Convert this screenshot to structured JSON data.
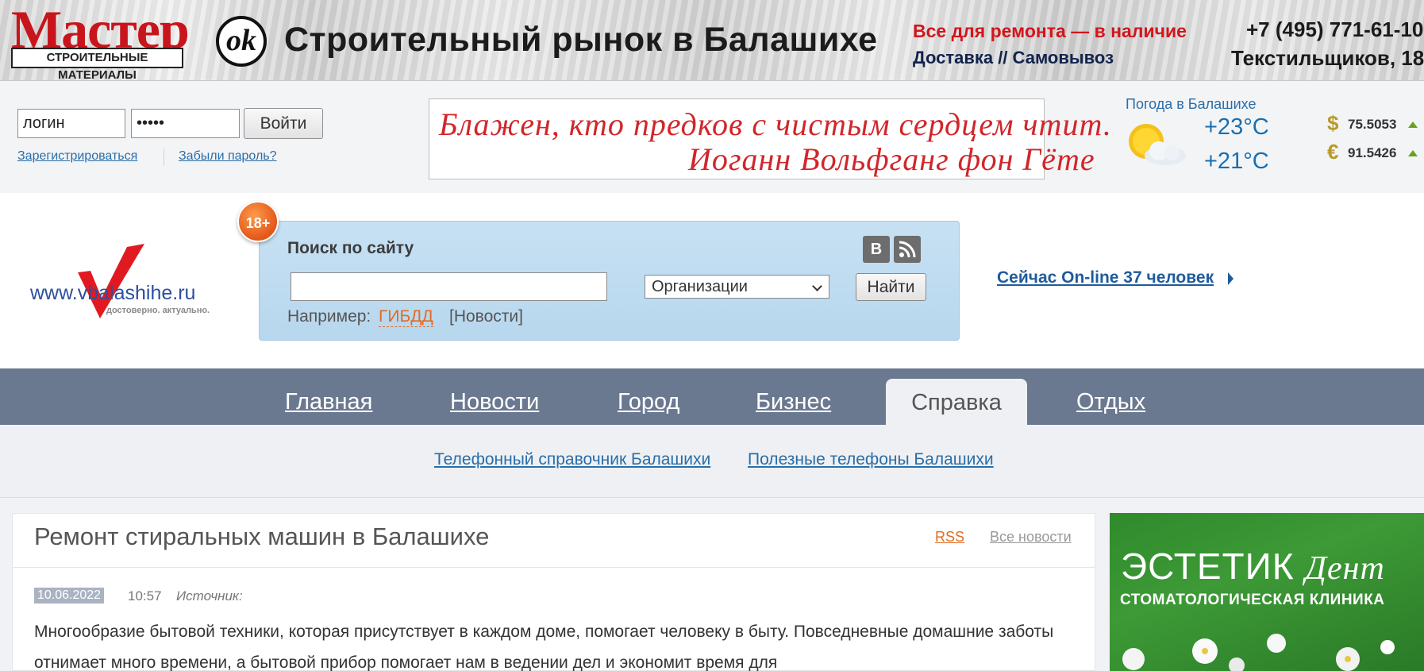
{
  "banner": {
    "brand": "Мастер",
    "brand_sub": "СТРОИТЕЛЬНЫЕ МАТЕРИАЛЫ",
    "brand_badge": "ok",
    "title": "Строительный рынок в Балашихе",
    "stock": "Все для ремонта — в наличие",
    "delivery": "Доставка // Самовывоз",
    "phone": "+7 (495) 771-61-10",
    "address": "Текстильщиков, 18"
  },
  "login": {
    "login_value": "логин",
    "password_value": "•••••",
    "submit_label": "Войти",
    "register_label": "Зарегистрироваться",
    "forgot_label": "Забыли пароль?"
  },
  "quote": {
    "line1": "Блажен, кто предков с чистым сердцем чтит.",
    "line2": "Иоганн Вольфганг фон Гёте"
  },
  "weather": {
    "title": "Погода в Балашихе",
    "icon": "partly-cloudy-icon",
    "temp_day": "+23°C",
    "temp_night": "+21°C"
  },
  "currency": [
    {
      "symbol": "$",
      "value": "75.5053",
      "trend": "up"
    },
    {
      "symbol": "€",
      "value": "91.5426",
      "trend": "up"
    }
  ],
  "site": {
    "logo_text": "www.vbalashihe.ru",
    "logo_sub": "достоверно. актуально.",
    "age": "18+"
  },
  "search": {
    "title": "Поиск по сайту",
    "social": [
      "В",
      "rss"
    ],
    "input_value": "",
    "select_value": "Организации",
    "submit_label": "Найти",
    "example_label": "Например:",
    "example_link1": "ГИБДД",
    "example_link2": "[Новости]"
  },
  "online": {
    "label": "Сейчас On-line 37 человек"
  },
  "nav": {
    "items": [
      "Главная",
      "Новости",
      "Город",
      "Бизнес",
      "Справка",
      "Отдых"
    ],
    "active": "Справка"
  },
  "subnav": {
    "items": [
      "Телефонный справочник Балашихи",
      "Полезные телефоны Балашихи"
    ]
  },
  "article": {
    "title": "Ремонт стиральных машин в Балашихе",
    "rss_label": "RSS",
    "all_news_label": "Все новости",
    "date": "10.06.2022",
    "time": "10:57",
    "source_label": "Источник:",
    "text": "Многообразие бытовой техники, которая присутствует в каждом доме, помогает человеку в быту. Повседневные домашние заботы отнимает много времени, а бытовой прибор помогает нам в ведении дел и экономит время для"
  },
  "ad": {
    "title": "ЭСТЕТИК",
    "title_script": "Дент",
    "subtitle": "СТОМАТОЛОГИЧЕСКАЯ КЛИНИКА"
  },
  "colors": {
    "nav_bg": "#6a7990",
    "link": "#2a6ea8",
    "accent_orange": "#e26b22",
    "brand_red": "#c8151b",
    "ad_green": "#3d9a36"
  }
}
